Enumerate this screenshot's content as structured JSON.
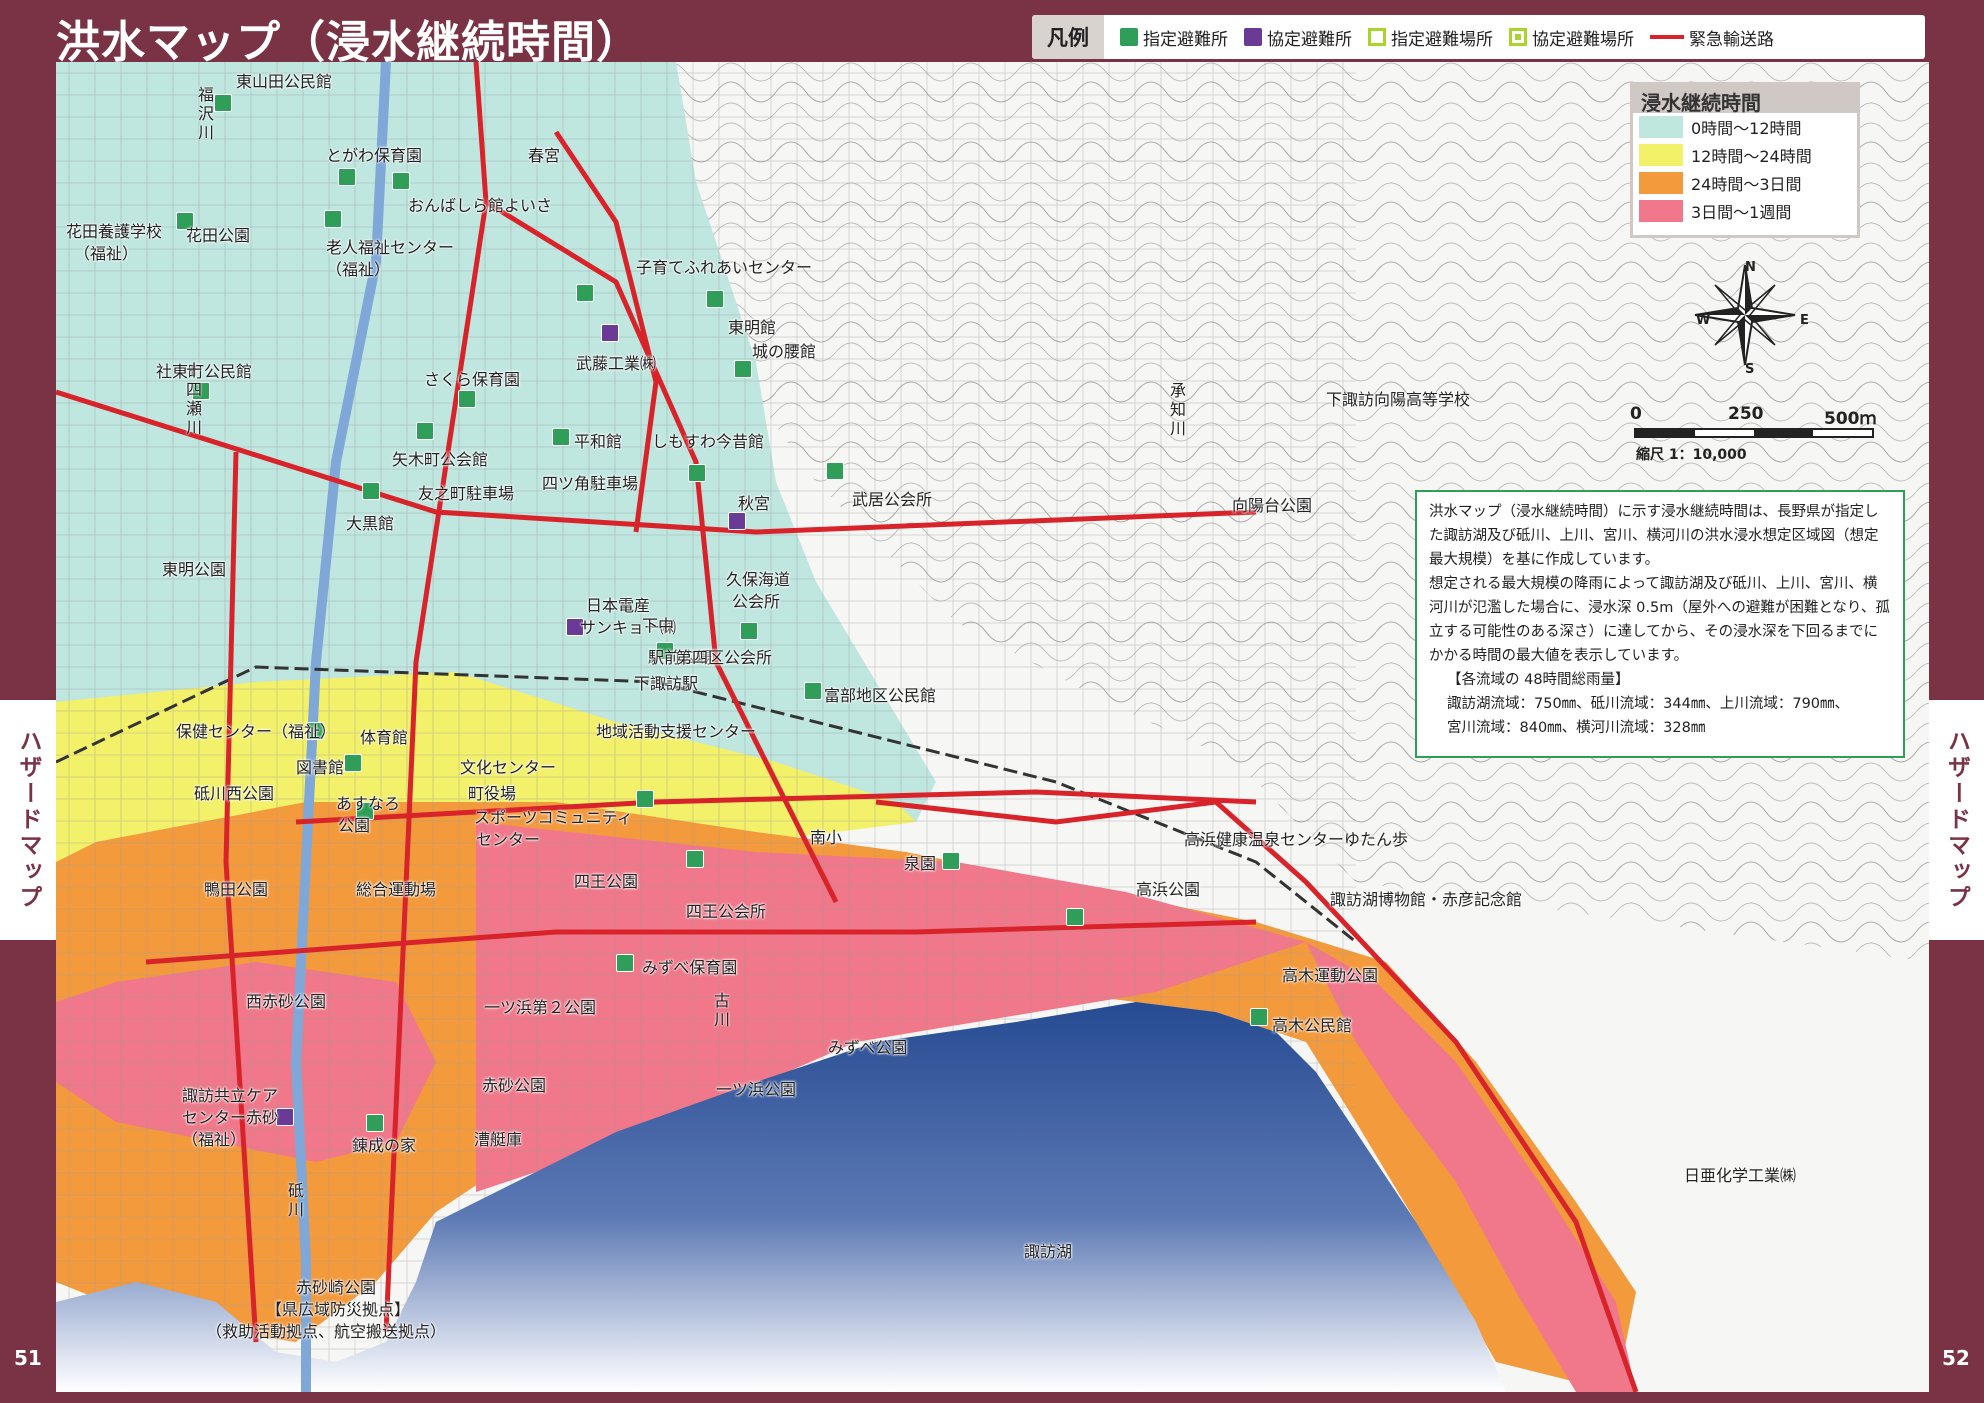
{
  "title": "洪水マップ（浸水継続時間）",
  "legend": {
    "head": "凡例",
    "items": [
      {
        "label": "指定避難所",
        "icon": "green-shelter-icon"
      },
      {
        "label": "協定避難所",
        "icon": "purple-shelter-icon"
      },
      {
        "label": "指定避難場所",
        "icon": "green-ring-icon"
      },
      {
        "label": "協定避難場所",
        "icon": "green-ring-dot-icon"
      },
      {
        "label": "緊急輸送路",
        "icon": "red-line-icon"
      }
    ]
  },
  "duration_legend": {
    "title": "浸水継続時間",
    "rows": [
      {
        "label": "0時間～12時間",
        "color": "#bfe6df"
      },
      {
        "label": "12時間～24時間",
        "color": "#f3f06a"
      },
      {
        "label": "24時間～3日間",
        "color": "#f39a3d"
      },
      {
        "label": "3日間～1週間",
        "color": "#f0788a"
      }
    ]
  },
  "scale": {
    "l0": "0",
    "l250": "250",
    "l500": "500ｍ",
    "ratio": "縮尺 1：10,000"
  },
  "compass": {
    "n": "N",
    "s": "S",
    "e": "E",
    "w": "W"
  },
  "note": {
    "p1": "洪水マップ（浸水継続時間）に示す浸水継続時間は、長野県が指定した諏訪湖及び砥川、上川、宮川、横河川の洪水浸水想定区域図（想定最大規模）を基に作成しています。",
    "p2": "想定される最大規模の降雨によって諏訪湖及び砥川、上川、宮川、横河川が氾濫した場合に、浸水深 0.5m（屋外への避難が困難となり、孤立する可能性のある深さ）に達してから、その浸水深を下回るまでにかかる時間の最大値を表示しています。",
    "p3": "【各流域の 48時間総雨量】",
    "p4": "諏訪湖流域：750㎜、砥川流域：344㎜、上川流域：790㎜、",
    "p5": "宮川流域：840㎜、横河川流域：328㎜"
  },
  "side_left": "ハザードマップ",
  "side_right": "ハザードマップ",
  "page_left": "51",
  "page_right": "52",
  "colors": {
    "frame": "#7a3344",
    "lake_top": "#264b92",
    "lake_bottom": "#ffffff",
    "road": "#d8232a",
    "shelter": "#2e9e58",
    "agreement": "#6a3a97"
  },
  "labels": [
    {
      "id": "higashiyamada",
      "text": "東山田公民館"
    },
    {
      "id": "togawa",
      "text": "とがわ保育園"
    },
    {
      "id": "harumiya",
      "text": "春宮"
    },
    {
      "id": "onbashira",
      "text": "おんばしら館よいさ"
    },
    {
      "id": "hanada-gakko",
      "text": "花田養護学校"
    },
    {
      "id": "hanada-gakko-2",
      "text": "（福祉）"
    },
    {
      "id": "hanada-park",
      "text": "花田公園"
    },
    {
      "id": "roujin",
      "text": "老人福祉センター"
    },
    {
      "id": "roujin-2",
      "text": "（福祉）"
    },
    {
      "id": "kosodate",
      "text": "子育てふれあいセンター"
    },
    {
      "id": "tomei",
      "text": "東明館"
    },
    {
      "id": "shironokoshi",
      "text": "城の腰館"
    },
    {
      "id": "muto",
      "text": "武藤工業㈱"
    },
    {
      "id": "sakura",
      "text": "さくら保育園"
    },
    {
      "id": "shatohmachi",
      "text": "社東町公民館"
    },
    {
      "id": "shimosuwa-koko",
      "text": "下諏訪向陽高等学校"
    },
    {
      "id": "yagimachi",
      "text": "矢木町公会館"
    },
    {
      "id": "heiwa",
      "text": "平和館"
    },
    {
      "id": "shimosuwa-imamukashi",
      "text": "しもすわ今昔館"
    },
    {
      "id": "tomonomachi",
      "text": "友之町駐車場"
    },
    {
      "id": "yotsukado",
      "text": "四ツ角駐車場"
    },
    {
      "id": "daikoku",
      "text": "大黒館"
    },
    {
      "id": "akimiya",
      "text": "秋宮"
    },
    {
      "id": "takesui",
      "text": "武居公会所"
    },
    {
      "id": "koyodai",
      "text": "向陽台公園"
    },
    {
      "id": "tomei-park",
      "text": "東明公園"
    },
    {
      "id": "nihondensan",
      "text": "日本電産"
    },
    {
      "id": "sankyo",
      "text": "サンキョー㈱"
    },
    {
      "id": "kubokaido",
      "text": "久保海道"
    },
    {
      "id": "kubokaido-2",
      "text": "公会所"
    },
    {
      "id": "shimonaka",
      "text": "下中"
    },
    {
      "id": "ekimae",
      "text": "駅前広場"
    },
    {
      "id": "daiyonku",
      "text": "第四区公会所"
    },
    {
      "id": "shimosuwa-eki",
      "text": "下諏訪駅"
    },
    {
      "id": "tomibe",
      "text": "富部地区公民館"
    },
    {
      "id": "hoken",
      "text": "保健センター（福祉）"
    },
    {
      "id": "taiikukan",
      "text": "体育館"
    },
    {
      "id": "chiiki",
      "text": "地域活動支援センター"
    },
    {
      "id": "toshokan",
      "text": "図書館"
    },
    {
      "id": "bunka",
      "text": "文化センター"
    },
    {
      "id": "togawanishi",
      "text": "砥川西公園"
    },
    {
      "id": "asunaro",
      "text": "あすなろ"
    },
    {
      "id": "asunaro-2",
      "text": "公園"
    },
    {
      "id": "yakuba",
      "text": "町役場"
    },
    {
      "id": "sports",
      "text": "スポーツコミュニティ"
    },
    {
      "id": "sports-2",
      "text": "センター"
    },
    {
      "id": "nansho",
      "text": "南小"
    },
    {
      "id": "takahama-onsen",
      "text": "高浜健康温泉センターゆたん歩"
    },
    {
      "id": "shiou-park",
      "text": "四王公園"
    },
    {
      "id": "izumien",
      "text": "泉園"
    },
    {
      "id": "kamota",
      "text": "鴨田公園"
    },
    {
      "id": "sogo",
      "text": "総合運動場"
    },
    {
      "id": "takahama-park",
      "text": "高浜公園"
    },
    {
      "id": "suwako-museum",
      "text": "諏訪湖博物館・赤彦記念館"
    },
    {
      "id": "shiou-kokaisho",
      "text": "四王公会所"
    },
    {
      "id": "mizube-hoiku",
      "text": "みずべ保育園"
    },
    {
      "id": "takagi-undo",
      "text": "高木運動公園"
    },
    {
      "id": "nishiakasuna",
      "text": "西赤砂公園"
    },
    {
      "id": "hitotsuhama2",
      "text": "一ツ浜第２公園"
    },
    {
      "id": "mizube-park",
      "text": "みずべ公園"
    },
    {
      "id": "takagi-kominkan",
      "text": "高木公民館"
    },
    {
      "id": "akasuna-park",
      "text": "赤砂公園"
    },
    {
      "id": "hitotsuhama",
      "text": "一ツ浜公園"
    },
    {
      "id": "kyoritsu",
      "text": "諏訪共立ケア"
    },
    {
      "id": "kyoritsu-2",
      "text": "センター赤砂"
    },
    {
      "id": "kyoritsu-3",
      "text": "（福祉）"
    },
    {
      "id": "rensei",
      "text": "錬成の家"
    },
    {
      "id": "sotei",
      "text": "漕艇庫"
    },
    {
      "id": "nichia",
      "text": "日亜化学工業㈱"
    },
    {
      "id": "suwako",
      "text": "諏訪湖"
    },
    {
      "id": "akasunazaki",
      "text": "赤砂崎公園"
    },
    {
      "id": "kenkoiki",
      "text": "【県広域防災拠点】"
    },
    {
      "id": "kyujo",
      "text": "（救助活動拠点、航空搬送拠点）"
    }
  ],
  "vlabels": [
    {
      "id": "hanadasawa",
      "text": "福沢川"
    },
    {
      "id": "jushisegawa",
      "text": "十四瀬川"
    },
    {
      "id": "shochigawa",
      "text": "承知川"
    },
    {
      "id": "furukawa",
      "text": "古川"
    },
    {
      "id": "togawa-river",
      "text": "砥川"
    }
  ]
}
